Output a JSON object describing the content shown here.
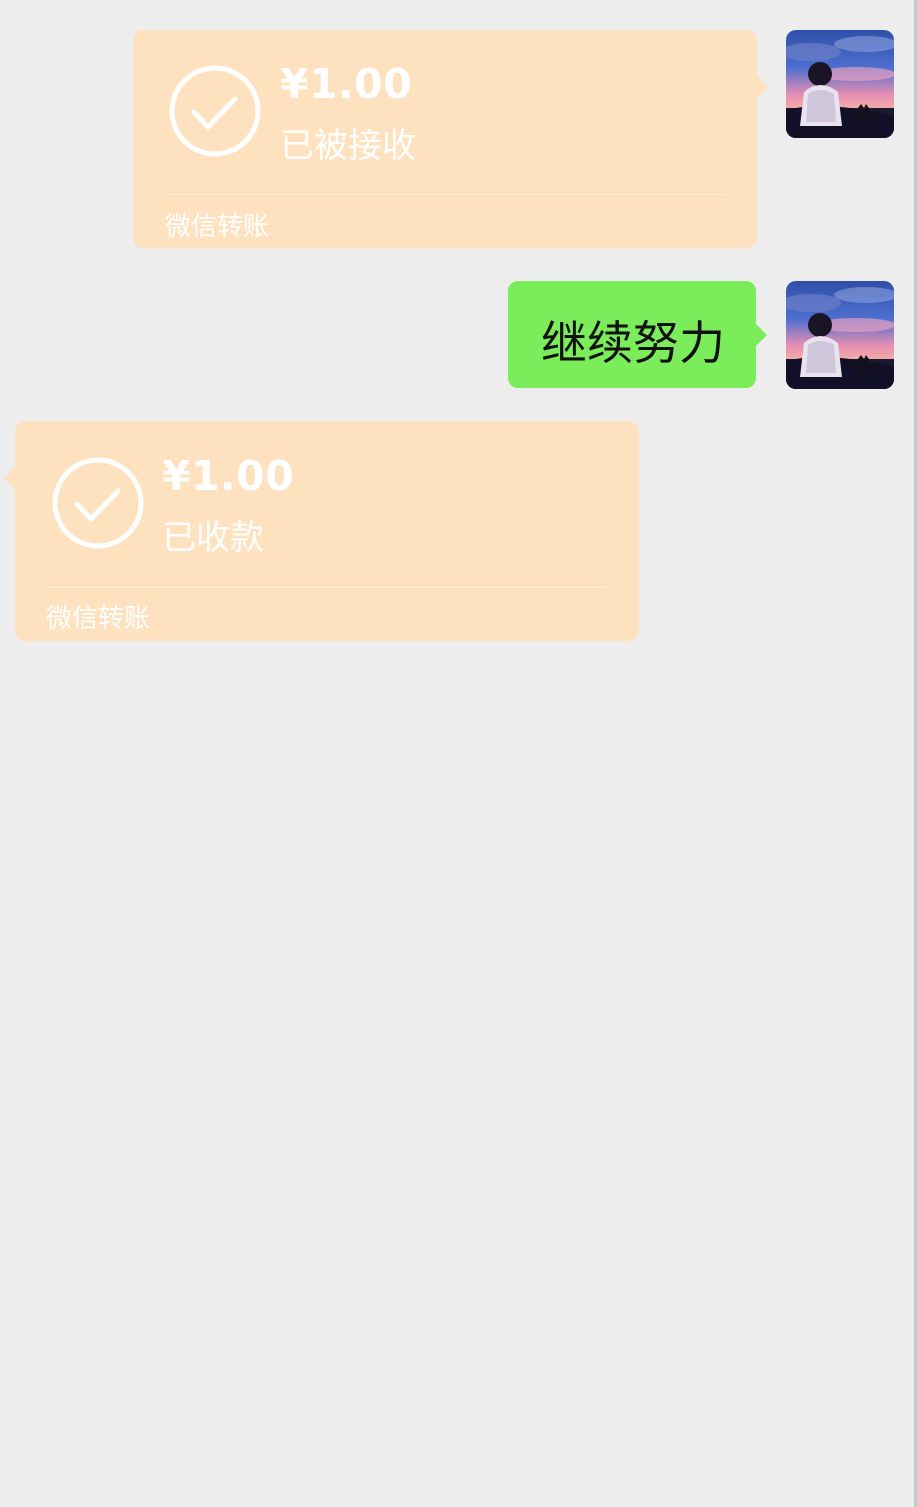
{
  "colors": {
    "background": "#ededed",
    "transfer_card": "#fee2bf",
    "text_bubble": "#7bed5b",
    "white": "#ffffff"
  },
  "messages": [
    {
      "type": "transfer",
      "direction": "outgoing",
      "amount": "¥1.00",
      "status": "已被接收",
      "footer": "微信转账",
      "icon": "check-circle-icon"
    },
    {
      "type": "text",
      "direction": "outgoing",
      "text": "继续努力"
    },
    {
      "type": "transfer",
      "direction": "incoming",
      "amount": "¥1.00",
      "status": "已收款",
      "footer": "微信转账",
      "icon": "check-circle-icon"
    }
  ],
  "avatar": {
    "icon": "user-avatar"
  }
}
